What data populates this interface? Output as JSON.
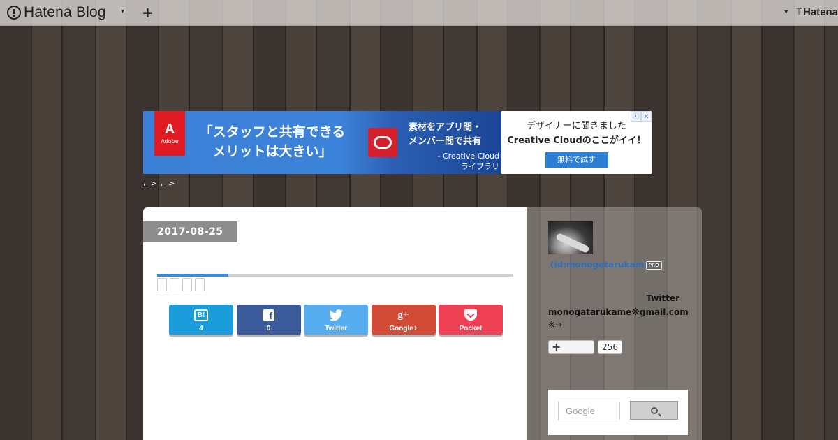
{
  "topbar": {
    "logo_text": "Hatena Blog",
    "caret": "▾",
    "plus": "+",
    "right_caret": "▾",
    "right_brand": "Hatena"
  },
  "ad": {
    "adobe_logo": "A",
    "adobe_text": "Adobe",
    "headline_line1": "「スタッフと共有できる",
    "headline_line2": "メリットは大きい」",
    "mid_line1": "素材をアプリ間・",
    "mid_line2": "メンバー間で共有",
    "mid_line3": "- Creative Cloud",
    "mid_line4": "ライブラリ",
    "right_line1": "デザイナーに聞きました",
    "right_line2": "Creative Cloudのここがイイ！",
    "cta": "無料で試す",
    "info_icon": "ⓘ",
    "close_icon": "✕",
    "colors": {
      "adobe_red": "#e01b22",
      "cta_blue": "#2d7fd6"
    }
  },
  "breadcrumb": "⌞ > ⌞ >",
  "article": {
    "date": "2017-08-25",
    "progress": 0.2,
    "share": [
      {
        "name": "hatena-bookmark",
        "icon": "B!",
        "label": "4",
        "color": "#1b9ddc"
      },
      {
        "name": "facebook",
        "icon": "f",
        "label": "0",
        "color": "#3b5a9a"
      },
      {
        "name": "twitter",
        "icon": "twitter-bird",
        "label": "Twitter",
        "color": "#55acee"
      },
      {
        "name": "google-plus",
        "icon": "g+",
        "label": "Google+",
        "color": "#d24b37"
      },
      {
        "name": "pocket",
        "icon": "pocket-icon",
        "label": "Pocket",
        "color": "#ef4156"
      }
    ]
  },
  "sidebar": {
    "user_id": "(id:monogatarukam)",
    "pro": "PRO",
    "twitter_label": "Twitter",
    "email": "monogatarukame※gmail.com",
    "note": "※→",
    "follow_icon": "+",
    "follow_count": "256",
    "search_placeholder": "Google"
  }
}
